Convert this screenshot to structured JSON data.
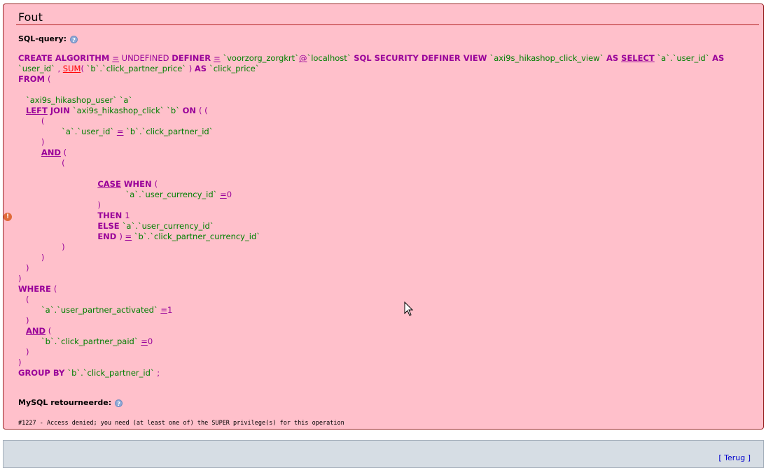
{
  "error": {
    "title": "Fout",
    "sql_label": "SQL-query:",
    "mysql_label": "MySQL retourneerde:",
    "mysql_message": "#1227 - Access denied; you need (at least one of) the SUPER privilege(s) for this operation"
  },
  "sql_lines": [
    [
      [
        "kw",
        "CREATE ALGORITHM "
      ],
      [
        "opu",
        "="
      ],
      [
        "kwplain",
        " UNDEFINED "
      ],
      [
        "kw",
        "DEFINER "
      ],
      [
        "opu",
        "="
      ],
      [
        "id",
        " `voorzorg_zorgkrt`"
      ],
      [
        "opu",
        "@"
      ],
      [
        "id",
        "`localhost` "
      ],
      [
        "kw",
        "SQL SECURITY DEFINER VIEW "
      ],
      [
        "id",
        "`axi9s_hikashop_click_view` "
      ],
      [
        "kw",
        "AS "
      ],
      [
        "kwu",
        "SELECT"
      ],
      [
        "id",
        " `a`.`user_id` "
      ],
      [
        "kw",
        "AS"
      ]
    ],
    [
      [
        "id",
        "`user_id` "
      ],
      [
        "op",
        ", "
      ],
      [
        "fn",
        "SUM"
      ],
      [
        "op",
        "( "
      ],
      [
        "id",
        "`b`.`click_partner_price` "
      ],
      [
        "op",
        ") "
      ],
      [
        "kw",
        "AS "
      ],
      [
        "id",
        "`click_price`"
      ]
    ],
    [
      [
        "kw",
        "FROM "
      ],
      [
        "op",
        "("
      ]
    ],
    [],
    [
      [
        "id",
        "   `axi9s_hikashop_user` `a`"
      ]
    ],
    [
      [
        "op",
        "   "
      ],
      [
        "kwu",
        "LEFT"
      ],
      [
        "kw",
        " JOIN "
      ],
      [
        "id",
        "`axi9s_hikashop_click` `b` "
      ],
      [
        "kw",
        "ON "
      ],
      [
        "op",
        "( ("
      ]
    ],
    [
      [
        "op",
        "         ("
      ]
    ],
    [
      [
        "id",
        "                 `a`.`user_id` "
      ],
      [
        "opu",
        "="
      ],
      [
        "id",
        " `b`.`click_partner_id`"
      ]
    ],
    [
      [
        "op",
        "         )"
      ]
    ],
    [
      [
        "op",
        "         "
      ],
      [
        "kwu",
        "AND"
      ],
      [
        "op",
        " ("
      ]
    ],
    [
      [
        "op",
        "                 ("
      ]
    ],
    [],
    [
      [
        "op",
        "                               "
      ],
      [
        "kwu",
        "CASE"
      ],
      [
        "kw",
        " WHEN "
      ],
      [
        "op",
        "("
      ]
    ],
    [
      [
        "id",
        "                                          `a`.`user_currency_id` "
      ],
      [
        "opu",
        "="
      ],
      [
        "num",
        "0"
      ]
    ],
    [
      [
        "op",
        "                               )"
      ]
    ],
    [
      [
        "op",
        "                               "
      ],
      [
        "kw",
        "THEN "
      ],
      [
        "num",
        "1"
      ]
    ],
    [
      [
        "op",
        "                               "
      ],
      [
        "kw",
        "ELSE "
      ],
      [
        "id",
        "`a`.`user_currency_id`"
      ]
    ],
    [
      [
        "op",
        "                               "
      ],
      [
        "kw",
        "END "
      ],
      [
        "op",
        ") "
      ],
      [
        "opu",
        "="
      ],
      [
        "id",
        " `b`.`click_partner_currency_id`"
      ]
    ],
    [
      [
        "op",
        "                 )"
      ]
    ],
    [
      [
        "op",
        "         )"
      ]
    ],
    [
      [
        "op",
        "   )"
      ]
    ],
    [
      [
        "op",
        ")"
      ]
    ],
    [
      [
        "kw",
        "WHERE "
      ],
      [
        "op",
        "("
      ]
    ],
    [
      [
        "op",
        "   ("
      ]
    ],
    [
      [
        "id",
        "         `a`.`user_partner_activated` "
      ],
      [
        "opu",
        "="
      ],
      [
        "num",
        "1"
      ]
    ],
    [
      [
        "op",
        "   )"
      ]
    ],
    [
      [
        "op",
        "   "
      ],
      [
        "kwu",
        "AND"
      ],
      [
        "op",
        " ("
      ]
    ],
    [
      [
        "id",
        "         `b`.`click_partner_paid` "
      ],
      [
        "opu",
        "="
      ],
      [
        "num",
        "0"
      ]
    ],
    [
      [
        "op",
        "   )"
      ]
    ],
    [
      [
        "op",
        ")"
      ]
    ],
    [
      [
        "kw",
        "GROUP BY "
      ],
      [
        "id",
        "`b`.`click_partner_id` "
      ],
      [
        "op",
        ";"
      ]
    ]
  ],
  "footer": {
    "back_link": "[ Terug ]"
  },
  "icons": {
    "help": "help-icon",
    "error": "error-icon",
    "cursor": "mouse-pointer-icon"
  }
}
